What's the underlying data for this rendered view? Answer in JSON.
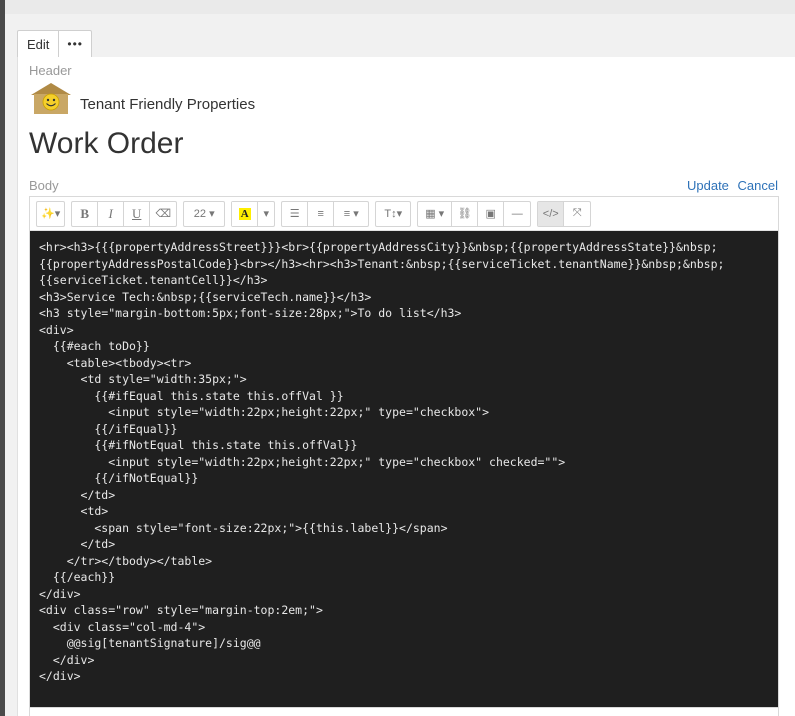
{
  "toolbar": {
    "edit_label": "Edit",
    "more_label": "•••"
  },
  "header": {
    "section_label": "Header",
    "company_name": "Tenant Friendly Properties"
  },
  "page": {
    "title": "Work Order"
  },
  "body_section": {
    "label": "Body",
    "update_label": "Update",
    "cancel_label": "Cancel"
  },
  "editor_toolbar": {
    "magic": "✨▾",
    "bold": "B",
    "italic": "I",
    "underline": "U",
    "eraser": "⌫",
    "font_size": "22 ▾",
    "highlight": "A",
    "highlight_dropdown": "▾",
    "ul": "☰",
    "ol": "≡",
    "align": "≡ ▾",
    "text_style": "T↕▾",
    "table": "▦ ▾",
    "link": "⛓",
    "image": "▣",
    "hr": "—",
    "code_view": "</>",
    "fullscreen": "⤧"
  },
  "code_lines": [
    "<hr><h3>{{{propertyAddressStreet}}}<br>{{propertyAddressCity}}&nbsp;{{propertyAddressState}}&nbsp;",
    "{{propertyAddressPostalCode}}<br></h3><hr><h3>Tenant:&nbsp;{{serviceTicket.tenantName}}&nbsp;&nbsp;",
    "{{serviceTicket.tenantCell}}</h3>",
    "<h3>Service Tech:&nbsp;{{serviceTech.name}}</h3>",
    "<h3 style=\"margin-bottom:5px;font-size:28px;\">To do list</h3>",
    "<div>",
    "  {{#each toDo}}",
    "    <table><tbody><tr>",
    "      <td style=\"width:35px;\">",
    "        {{#ifEqual this.state this.offVal }}",
    "          <input style=\"width:22px;height:22px;\" type=\"checkbox\">",
    "        {{/ifEqual}}",
    "        {{#ifNotEqual this.state this.offVal}}",
    "          <input style=\"width:22px;height:22px;\" type=\"checkbox\" checked=\"\">",
    "        {{/ifNotEqual}}",
    "      </td>",
    "      <td>",
    "        <span style=\"font-size:22px;\">{{this.label}}</span>",
    "      </td>",
    "    </tr></tbody></table>",
    "  {{/each}}",
    "</div>",
    "<div class=\"row\" style=\"margin-top:2em;\">",
    "  <div class=\"col-md-4\">",
    "    @@sig[tenantSignature]/sig@@",
    "  </div>",
    "</div>"
  ],
  "colors": {
    "accent": "#2e72b8",
    "code_bg": "#1f1f1f",
    "highlight": "#ffef00"
  }
}
